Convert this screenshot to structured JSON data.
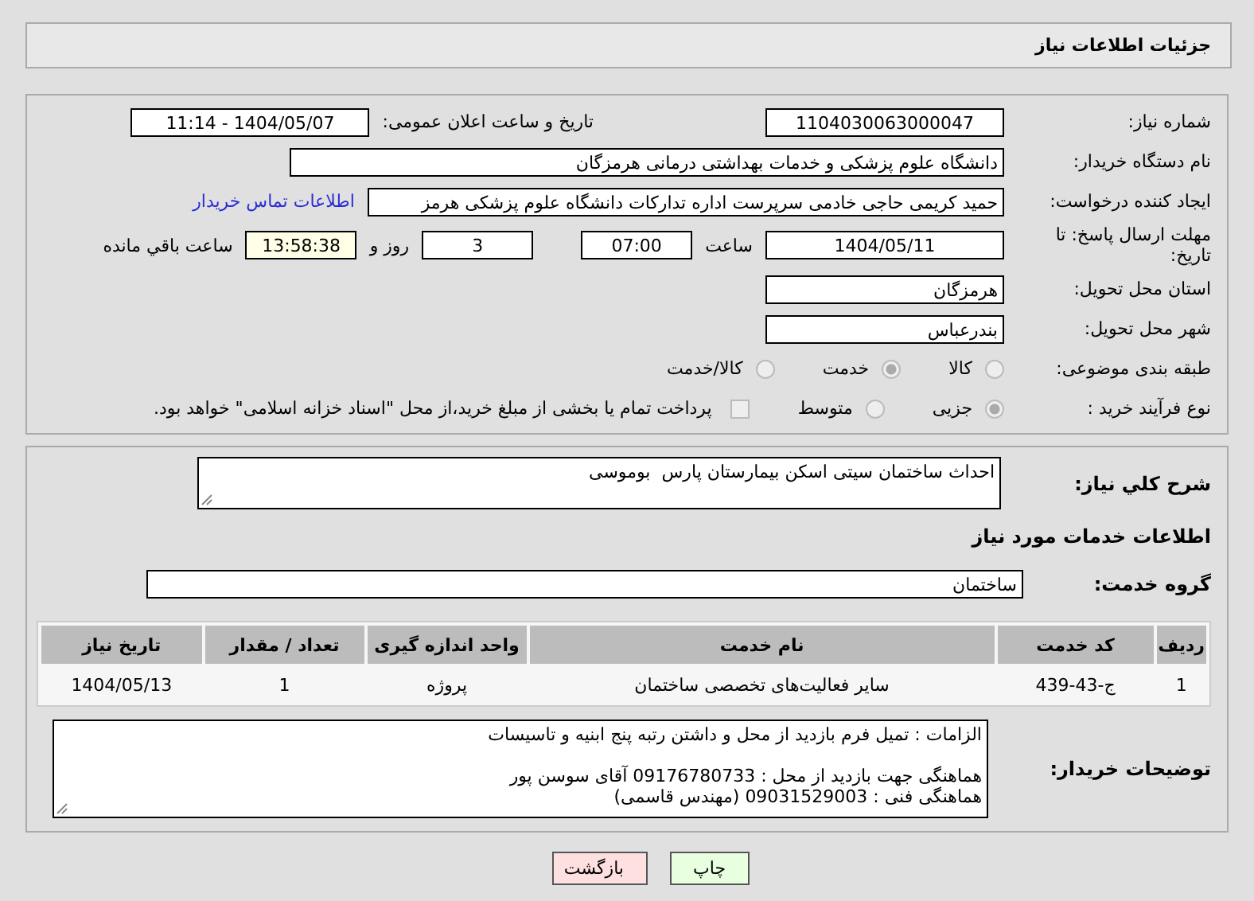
{
  "header": {
    "title": "جزئیات اطلاعات نیاز"
  },
  "details": {
    "need_number": {
      "label": "شماره نیاز:",
      "value": "1104030063000047"
    },
    "announce": {
      "label": "تاریخ و ساعت اعلان عمومی:",
      "value": "1404/05/07 - 11:14"
    },
    "buyer_org": {
      "label": "نام دستگاه خریدار:",
      "value": "دانشگاه علوم پزشکی و خدمات بهداشتی درمانی هرمزگان"
    },
    "requester": {
      "label": "ایجاد کننده درخواست:",
      "value": "حمید کریمی حاجی خادمی سرپرست اداره تدارکات دانشگاه علوم پزشکی هرمز"
    },
    "contact_link": "اطلاعات تماس خریدار",
    "deadline": {
      "label": "مهلت ارسال پاسخ: تا تاریخ:",
      "date": "1404/05/11",
      "time_label": "ساعت",
      "time": "07:00",
      "days": "3",
      "days_label": "روز و",
      "remaining": "13:58:38",
      "remaining_label": "ساعت باقي مانده"
    },
    "province": {
      "label": "استان محل تحویل:",
      "value": "هرمزگان"
    },
    "city": {
      "label": "شهر محل تحویل:",
      "value": "بندرعباس"
    },
    "category": {
      "label": "طبقه بندی موضوعی:",
      "options": [
        {
          "label": "کالا",
          "selected": false
        },
        {
          "label": "خدمت",
          "selected": true
        },
        {
          "label": "کالا/خدمت",
          "selected": false
        }
      ]
    },
    "process": {
      "label": "نوع فرآیند خرید :",
      "options": [
        {
          "label": "جزیی",
          "selected": true
        },
        {
          "label": "متوسط",
          "selected": false
        }
      ],
      "treasury": {
        "checked": false,
        "text": "پرداخت تمام یا بخشی از مبلغ خرید،از محل \"اسناد خزانه اسلامی\" خواهد بود."
      }
    }
  },
  "needs": {
    "summary": {
      "label": "شرح کلي نياز:",
      "value": "احداث ساختمان سیتی اسکن بیمارستان پارس  بوموسی"
    },
    "services_heading": "اطلاعات خدمات مورد نیاز",
    "service_group": {
      "label": "گروه خدمت:",
      "value": "ساختمان"
    },
    "table": {
      "columns": [
        "ردیف",
        "کد خدمت",
        "نام خدمت",
        "واحد اندازه گیری",
        "تعداد / مقدار",
        "تاریخ نیاز"
      ],
      "rows": [
        [
          "1",
          "ج-43-439",
          "سایر فعالیت‌های تخصصی ساختمان",
          "پروژه",
          "1",
          "1404/05/13"
        ]
      ]
    },
    "buyer_notes": {
      "label": "توضیحات خریدار:",
      "value": "الزامات : تمیل فرم بازدید از محل و داشتن رتبه پنج ابنیه و تاسیسات\n\nهماهنگی جهت بازدید از محل : 09176780733 آقای سوسن پور\nهماهنگی فنی : 09031529003 (مهندس قاسمی)"
    }
  },
  "buttons": [
    {
      "label": "چاپ",
      "kind": "print"
    },
    {
      "label": "بازگشت",
      "kind": "back"
    }
  ]
}
